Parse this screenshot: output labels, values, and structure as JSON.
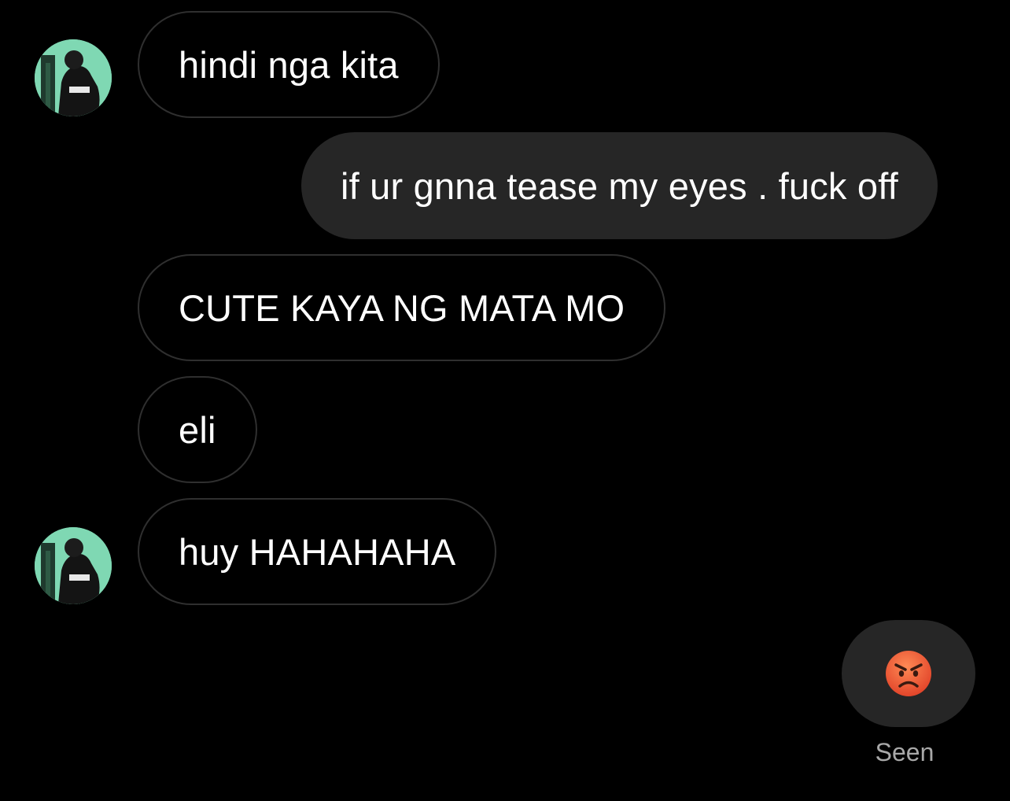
{
  "conversation": {
    "messages": [
      {
        "direction": "incoming",
        "text": "hindi nga kita",
        "show_avatar": true
      },
      {
        "direction": "outgoing",
        "text": "if ur gnna tease my eyes . fuck off"
      },
      {
        "direction": "incoming",
        "text": "CUTE KAYA NG MATA MO",
        "show_avatar": false
      },
      {
        "direction": "incoming",
        "text": "eli",
        "show_avatar": false
      },
      {
        "direction": "incoming",
        "text": "huy HAHAHAHA",
        "show_avatar": true
      },
      {
        "direction": "outgoing",
        "type": "emoji",
        "emoji": "angry-face-icon"
      }
    ],
    "status": "Seen"
  },
  "colors": {
    "background": "#000000",
    "outgoing_bubble": "#262626",
    "incoming_border": "#2f2f2f",
    "avatar_accent": "#7fd8b3",
    "seen_text": "#a8a8a8",
    "emoji_face": "#ef6a3a"
  }
}
